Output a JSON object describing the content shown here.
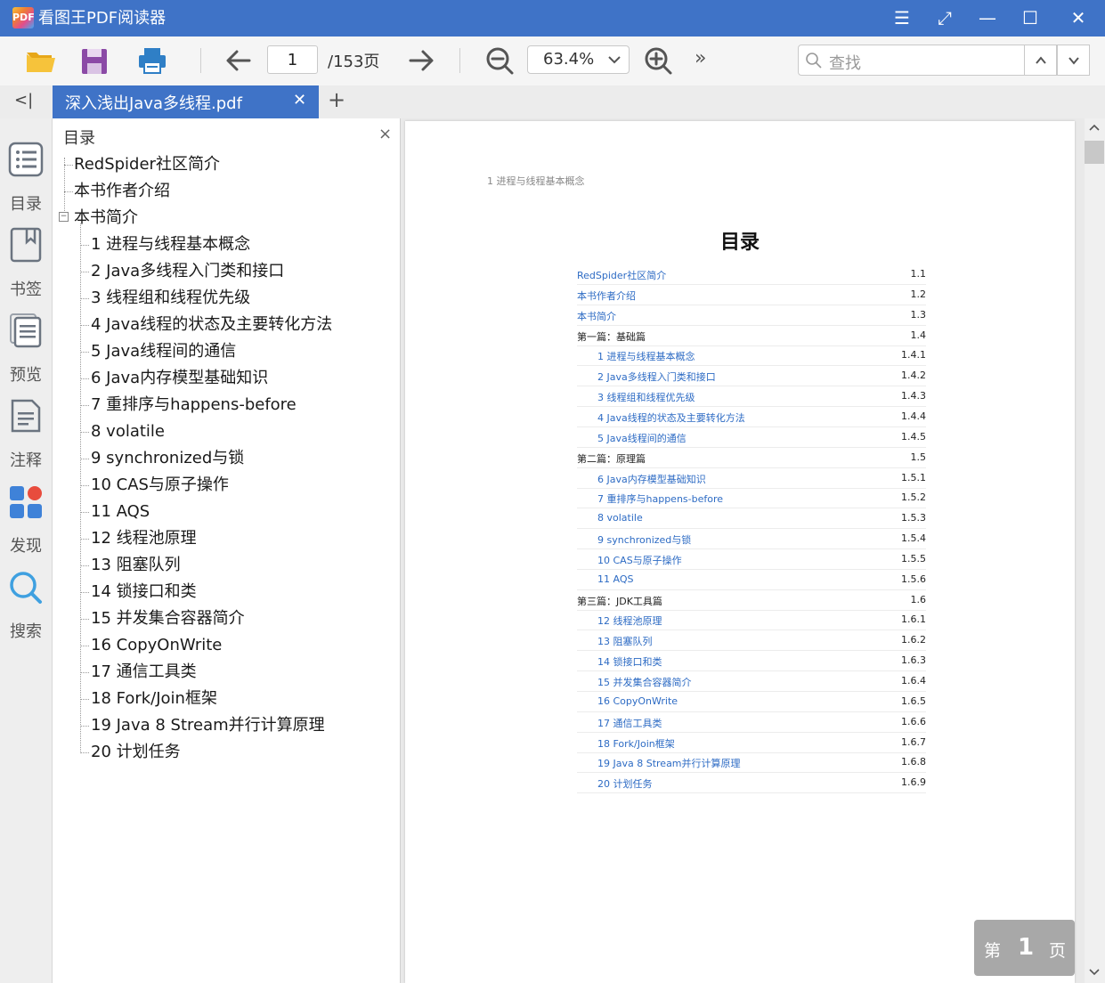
{
  "app": {
    "logo_text": "PDF",
    "title": "看图王PDF阅读器"
  },
  "window_controls": [
    "☰",
    "⤢",
    "—",
    "☐",
    "✕"
  ],
  "toolbar": {
    "current_page": "1",
    "total_pages": "/153页",
    "zoom": "63.4%",
    "more": "»",
    "search_placeholder": "查找"
  },
  "tabs": [
    {
      "label": "深入浅出Java多线程.pdf",
      "active": true
    }
  ],
  "tab_add": "+",
  "tab_close": "✕",
  "collapse": "<|",
  "rail": [
    {
      "label": "目录",
      "icon": "list-icon"
    },
    {
      "label": "书签",
      "icon": "bookmark-icon"
    },
    {
      "label": "预览",
      "icon": "preview-icon"
    },
    {
      "label": "注释",
      "icon": "annotation-icon"
    },
    {
      "label": "发现",
      "icon": "discover-icon"
    },
    {
      "label": "搜索",
      "icon": "search-icon"
    }
  ],
  "outline": {
    "title": "目录",
    "close": "×",
    "top_items": [
      "RedSpider社区简介",
      "本书作者介绍",
      "本书简介"
    ],
    "children": [
      "1 进程与线程基本概念",
      "2 Java多线程入门类和接口",
      "3 线程组和线程优先级",
      "4 Java线程的状态及主要转化方法",
      "5 Java线程间的通信",
      "6 Java内存模型基础知识",
      "7 重排序与happens-before",
      "8 volatile",
      "9 synchronized与锁",
      "10 CAS与原子操作",
      "11 AQS",
      "12 线程池原理",
      "13 阻塞队列",
      "14 锁接口和类",
      "15 并发集合容器简介",
      "16 CopyOnWrite",
      "17 通信工具类",
      "18 Fork/Join框架",
      "19 Java 8 Stream并行计算原理",
      "20 计划任务"
    ]
  },
  "document": {
    "header": "1 进程与线程基本概念",
    "title": "目录",
    "toc": [
      {
        "text": "RedSpider社区简介",
        "num": "1.1",
        "kind": "link",
        "level": 0
      },
      {
        "text": "本书作者介绍",
        "num": "1.2",
        "kind": "link",
        "level": 0
      },
      {
        "text": "本书简介",
        "num": "1.3",
        "kind": "link",
        "level": 0
      },
      {
        "text": "第一篇：基础篇",
        "num": "1.4",
        "kind": "section",
        "level": 0
      },
      {
        "text": "1 进程与线程基本概念",
        "num": "1.4.1",
        "kind": "link",
        "level": 1
      },
      {
        "text": "2 Java多线程入门类和接口",
        "num": "1.4.2",
        "kind": "link",
        "level": 1
      },
      {
        "text": "3 线程组和线程优先级",
        "num": "1.4.3",
        "kind": "link",
        "level": 1
      },
      {
        "text": "4 Java线程的状态及主要转化方法",
        "num": "1.4.4",
        "kind": "link",
        "level": 1
      },
      {
        "text": "5 Java线程间的通信",
        "num": "1.4.5",
        "kind": "link",
        "level": 1
      },
      {
        "text": "第二篇：原理篇",
        "num": "1.5",
        "kind": "section",
        "level": 0
      },
      {
        "text": "6 Java内存模型基础知识",
        "num": "1.5.1",
        "kind": "link",
        "level": 1
      },
      {
        "text": "7 重排序与happens-before",
        "num": "1.5.2",
        "kind": "link",
        "level": 1
      },
      {
        "text": "8 volatile",
        "num": "1.5.3",
        "kind": "link",
        "level": 1
      },
      {
        "text": "9 synchronized与锁",
        "num": "1.5.4",
        "kind": "link",
        "level": 1
      },
      {
        "text": "10 CAS与原子操作",
        "num": "1.5.5",
        "kind": "link",
        "level": 1
      },
      {
        "text": "11 AQS",
        "num": "1.5.6",
        "kind": "link",
        "level": 1
      },
      {
        "text": "第三篇：JDK工具篇",
        "num": "1.6",
        "kind": "section",
        "level": 0
      },
      {
        "text": "12 线程池原理",
        "num": "1.6.1",
        "kind": "link",
        "level": 1
      },
      {
        "text": "13 阻塞队列",
        "num": "1.6.2",
        "kind": "link",
        "level": 1
      },
      {
        "text": "14 锁接口和类",
        "num": "1.6.3",
        "kind": "link",
        "level": 1
      },
      {
        "text": "15 并发集合容器简介",
        "num": "1.6.4",
        "kind": "link",
        "level": 1
      },
      {
        "text": "16 CopyOnWrite",
        "num": "1.6.5",
        "kind": "link",
        "level": 1
      },
      {
        "text": "17 通信工具类",
        "num": "1.6.6",
        "kind": "link",
        "level": 1
      },
      {
        "text": "18 Fork/Join框架",
        "num": "1.6.7",
        "kind": "link",
        "level": 1
      },
      {
        "text": "19 Java 8 Stream并行计算原理",
        "num": "1.6.8",
        "kind": "link",
        "level": 1
      },
      {
        "text": "20 计划任务",
        "num": "1.6.9",
        "kind": "link",
        "level": 1
      }
    ]
  },
  "page_badge": {
    "prefix": "第",
    "number": "1",
    "suffix": "页"
  },
  "colors": {
    "title_bar": "#3f73c7",
    "link": "#2d6bc4",
    "badge": "#a8a8a8"
  }
}
